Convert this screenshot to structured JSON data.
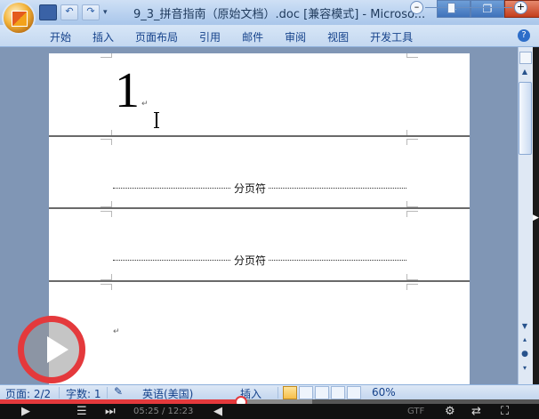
{
  "window": {
    "title": "9_3_拼音指南（原始文档）.doc [兼容模式] - Microso...",
    "controls": {
      "minimize": "–",
      "maximize": "❐",
      "close": "✕"
    }
  },
  "qat": {
    "undo": "↶",
    "redo": "↷",
    "more": "▾"
  },
  "ribbon": {
    "tabs": [
      "开始",
      "插入",
      "页面布局",
      "引用",
      "邮件",
      "审阅",
      "视图",
      "开发工具"
    ],
    "help": "?"
  },
  "document": {
    "big_number": "1",
    "paragraph_mark": "↵",
    "page_break_label": "分页符"
  },
  "scrollbar": {
    "up": "▲",
    "down": "▼",
    "prev_page": "▴",
    "browse_object": "●",
    "next_page": "▾"
  },
  "statusbar": {
    "page": "页面: 2/2",
    "words": "字数: 1",
    "language": "英语(美国)",
    "insert_mode": "插入",
    "zoom": "60%",
    "zoom_out": "–",
    "zoom_in": "+"
  },
  "player": {
    "progress": 0.445,
    "buffered": 0.58,
    "time": "05:25 / 12:23",
    "quality": "GTF",
    "icons": [
      "play-icon",
      "playlist-icon",
      "next-icon",
      "volume-icon",
      "settings-icon",
      "repeat-icon",
      "fullscreen-icon"
    ]
  },
  "colors": {
    "accent": "#e4393c",
    "ribbon_text": "#15428b"
  }
}
